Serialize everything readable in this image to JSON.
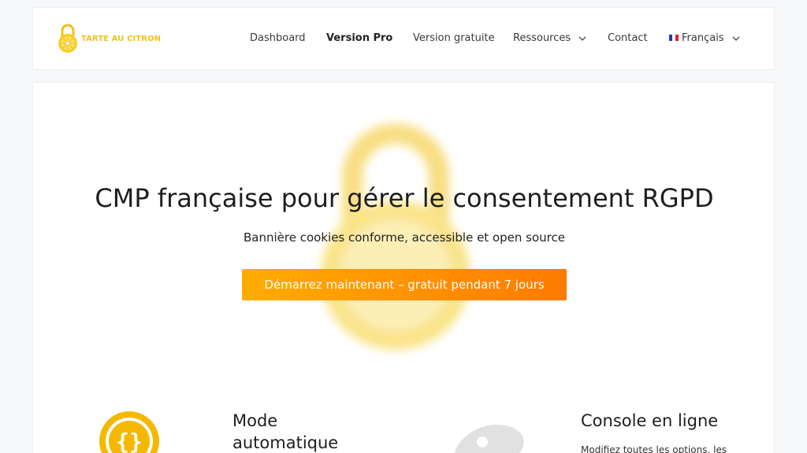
{
  "brand": {
    "name": "TARTE AU CITRON",
    "color": "#f2c21b"
  },
  "nav": {
    "items": [
      {
        "label": "Dashboard"
      },
      {
        "label": "Version Pro"
      },
      {
        "label": "Version gratuite"
      },
      {
        "label": "Ressources"
      },
      {
        "label": "Contact"
      },
      {
        "label": "Français"
      }
    ]
  },
  "hero": {
    "title": "CMP française pour gérer le consentement RGPD",
    "subtitle": "Bannière cookies conforme, accessible et open source",
    "cta_label": "Démarrez maintenant – gratuit pendant 7 jours",
    "cta_colors": [
      "#ffad00",
      "#ff7a00"
    ]
  },
  "features": [
    {
      "title_line1": "Mode",
      "title_line2": "automatique",
      "icon": "code-braces-icon"
    },
    {
      "title": "Console en ligne",
      "text": "Modifiez toutes les options, les",
      "icon": "palette-icon"
    }
  ]
}
